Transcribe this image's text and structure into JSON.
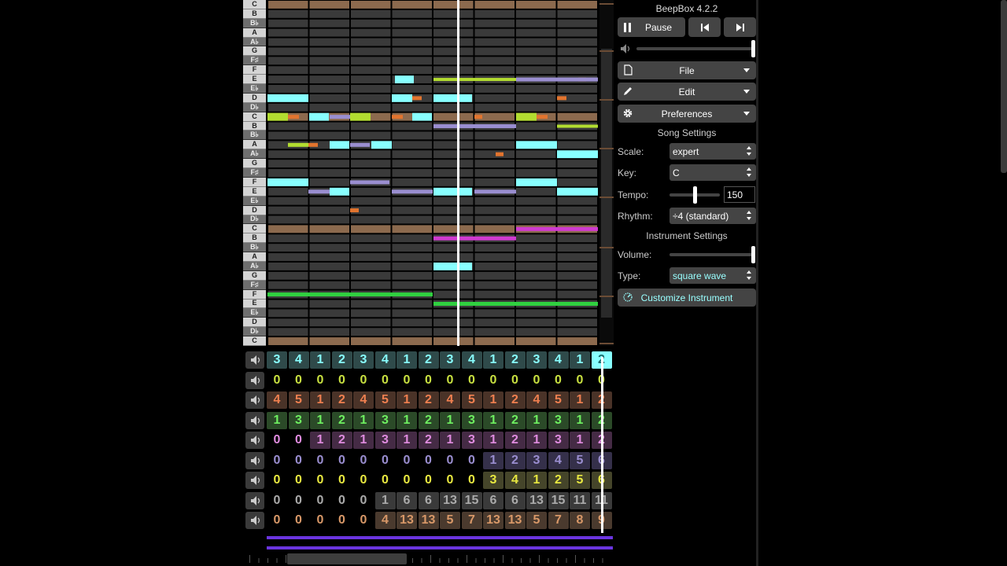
{
  "app": {
    "title": "BeepBox 4.2.2"
  },
  "transport": {
    "play_label": "Pause",
    "prev_icon": "skip-previous-icon",
    "next_icon": "skip-next-icon",
    "pause_icon": "pause-icon"
  },
  "master_volume": 1.0,
  "menus": [
    {
      "label": "File",
      "icon": "file-icon"
    },
    {
      "label": "Edit",
      "icon": "pencil-icon"
    },
    {
      "label": "Preferences",
      "icon": "gear-icon"
    }
  ],
  "song_settings": {
    "header": "Song Settings",
    "scale_label": "Scale:",
    "scale_value": "expert",
    "key_label": "Key:",
    "key_value": "C",
    "tempo_label": "Tempo:",
    "tempo_value": "150",
    "tempo_slider": 0.5,
    "rhythm_label": "Rhythm:",
    "rhythm_value": "÷4 (standard)"
  },
  "instrument_settings": {
    "header": "Instrument Settings",
    "volume_label": "Volume:",
    "volume_slider": 1.0,
    "type_label": "Type:",
    "type_value": "square wave",
    "customize_label": "Customize Instrument",
    "customize_icon": "dial-icon"
  },
  "piano_keys": [
    "C",
    "B",
    "B♭",
    "A",
    "A♭",
    "G",
    "F♯",
    "F",
    "E",
    "E♭",
    "D",
    "D♭",
    "C",
    "B",
    "B♭",
    "A",
    "A♭",
    "G",
    "F♯",
    "F",
    "E",
    "E♭",
    "D",
    "D♭",
    "C",
    "B",
    "B♭",
    "A",
    "A♭",
    "G",
    "F♯",
    "F",
    "E",
    "E♭",
    "D",
    "D♭",
    "C"
  ],
  "colors": {
    "cyan": "#8ff",
    "lime": "#b2dc30",
    "orange": "#e2742e",
    "lavender": "#9a8ed0",
    "magenta": "#d03ad0",
    "green": "#30d040",
    "grey": "#888888",
    "tan": "#b58868",
    "yellow": "#e8e840",
    "pink": "#e08ce0",
    "purple": "#6b35e0"
  },
  "pattern_rows": [
    {
      "color": "#8ff",
      "bg": "#2f4a4a",
      "values": [
        "3",
        "4",
        "1",
        "2",
        "3",
        "4",
        "1",
        "2",
        "3",
        "4",
        "1",
        "2",
        "3",
        "4",
        "1",
        "2"
      ]
    },
    {
      "color": "#c8e040",
      "bg": "#000",
      "values": [
        "0",
        "0",
        "0",
        "0",
        "0",
        "0",
        "0",
        "0",
        "0",
        "0",
        "0",
        "0",
        "0",
        "0",
        "0",
        "0"
      ]
    },
    {
      "color": "#f08050",
      "bg": "#4a3328",
      "values": [
        "4",
        "5",
        "1",
        "2",
        "4",
        "5",
        "1",
        "2",
        "4",
        "5",
        "1",
        "2",
        "4",
        "5",
        "1",
        "2"
      ]
    },
    {
      "color": "#6ef060",
      "bg": "#2b4a28",
      "values": [
        "1",
        "3",
        "1",
        "2",
        "1",
        "3",
        "1",
        "2",
        "1",
        "3",
        "1",
        "2",
        "1",
        "3",
        "1",
        "2"
      ]
    },
    {
      "color": "#e08ce0",
      "bg": "#452b45",
      "values": [
        "0",
        "0",
        "1",
        "2",
        "1",
        "3",
        "1",
        "2",
        "1",
        "3",
        "1",
        "2",
        "1",
        "3",
        "1",
        "2"
      ]
    },
    {
      "color": "#9a8ed0",
      "bg": "#35304a",
      "values": [
        "0",
        "0",
        "0",
        "0",
        "0",
        "0",
        "0",
        "0",
        "0",
        "0",
        "1",
        "2",
        "3",
        "4",
        "5",
        "6"
      ]
    },
    {
      "color": "#e8e840",
      "bg": "#45452a",
      "values": [
        "0",
        "0",
        "0",
        "0",
        "0",
        "0",
        "0",
        "0",
        "0",
        "0",
        "3",
        "4",
        "1",
        "2",
        "5",
        "6"
      ]
    },
    {
      "color": "#aaaaaa",
      "bg": "#3a3a3a",
      "values": [
        "0",
        "0",
        "0",
        "0",
        "0",
        "1",
        "6",
        "6",
        "13",
        "15",
        "6",
        "6",
        "13",
        "15",
        "11",
        "11"
      ]
    },
    {
      "color": "#d89868",
      "bg": "#4a3a2e",
      "values": [
        "0",
        "0",
        "0",
        "0",
        "0",
        "4",
        "13",
        "13",
        "5",
        "7",
        "13",
        "13",
        "5",
        "7",
        "8",
        "9"
      ]
    }
  ]
}
